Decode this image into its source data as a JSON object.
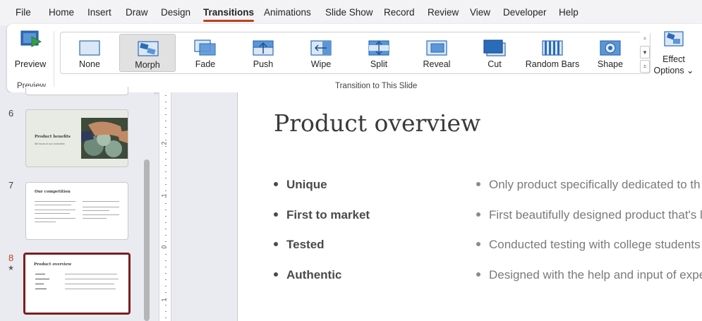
{
  "menu": {
    "tabs": [
      "File",
      "Home",
      "Insert",
      "Draw",
      "Design",
      "Transitions",
      "Animations",
      "Slide Show",
      "Record",
      "Review",
      "View",
      "Developer",
      "Help"
    ],
    "active_tab": "Transitions"
  },
  "ribbon": {
    "preview_group": {
      "button_label": "Preview",
      "group_label": "Preview"
    },
    "transitions_group": {
      "group_label": "Transition to This Slide",
      "items": [
        {
          "label": "None",
          "icon": "none-transition-icon"
        },
        {
          "label": "Morph",
          "icon": "morph-transition-icon",
          "selected": true
        },
        {
          "label": "Fade",
          "icon": "fade-transition-icon"
        },
        {
          "label": "Push",
          "icon": "push-transition-icon"
        },
        {
          "label": "Wipe",
          "icon": "wipe-transition-icon"
        },
        {
          "label": "Split",
          "icon": "split-transition-icon"
        },
        {
          "label": "Reveal",
          "icon": "reveal-transition-icon"
        },
        {
          "label": "Cut",
          "icon": "cut-transition-icon"
        },
        {
          "label": "Random Bars",
          "icon": "random-bars-transition-icon"
        },
        {
          "label": "Shape",
          "icon": "shape-transition-icon"
        }
      ]
    },
    "effect_options": {
      "line1": "Effect",
      "line2": "Options ⌄"
    }
  },
  "thumbnails": [
    {
      "number": "6",
      "title": "Product benefits",
      "subtitle": "We focus on our customers"
    },
    {
      "number": "7",
      "title": "Our competition"
    },
    {
      "number": "8",
      "title": "Product overview",
      "current": true
    }
  ],
  "ruler": {
    "labels": [
      "2",
      "1",
      "0",
      "1"
    ]
  },
  "slide": {
    "title": "Product overview",
    "left_bullets": [
      "Unique",
      "First to market",
      "Tested",
      "Authentic"
    ],
    "right_bullets": [
      "Only product specifically dedicated to th",
      "First beautifully designed product that's l",
      "Conducted testing with college students",
      "Designed with the help and input of expe"
    ]
  },
  "colors": {
    "accent": "#c43e1c",
    "current_slide_border": "#7a1f1f",
    "icon_blue": "#2b6cb8"
  }
}
